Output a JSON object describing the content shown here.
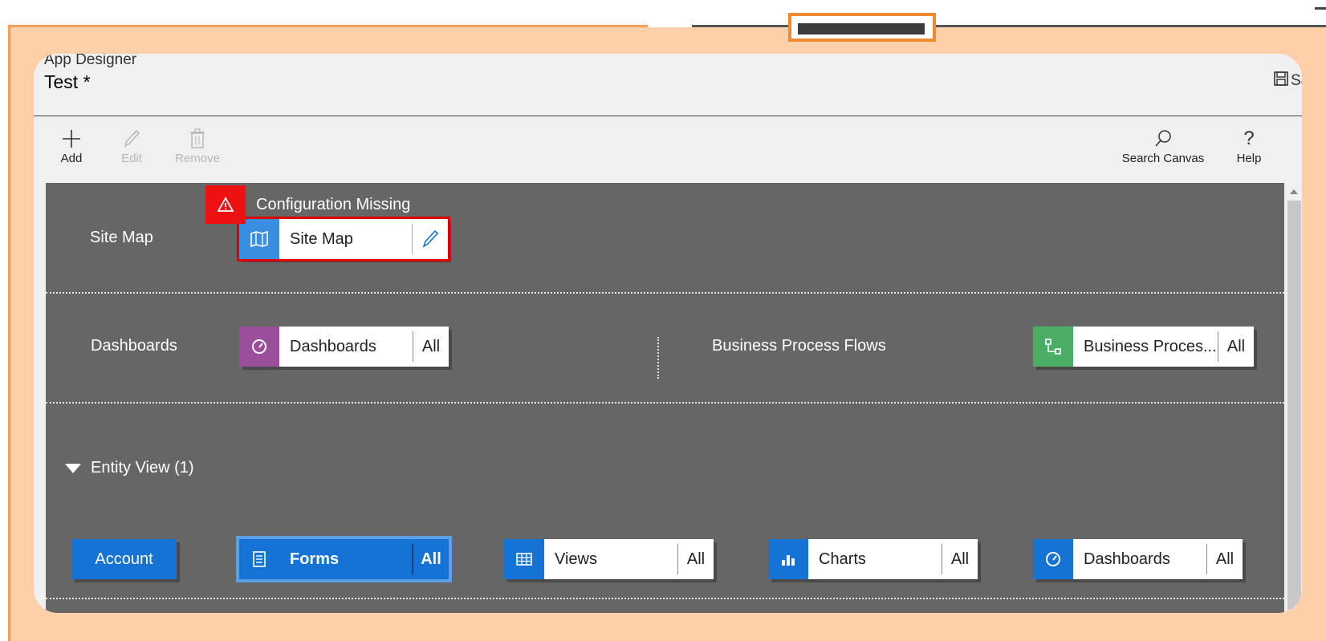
{
  "header": {
    "app_label": "App Designer",
    "title": "Test *",
    "save_label": "Sa"
  },
  "toolbar": {
    "add": "Add",
    "edit": "Edit",
    "remove": "Remove",
    "search_canvas": "Search Canvas",
    "help": "Help"
  },
  "sitemap_row": {
    "label": "Site Map",
    "warning": "Configuration Missing",
    "tile_label": "Site Map"
  },
  "dashboards_row": {
    "label": "Dashboards",
    "tile_label": "Dashboards",
    "tile_all": "All",
    "bpf_label": "Business Process Flows",
    "bpf_tile_label": "Business Proces...",
    "bpf_tile_all": "All"
  },
  "entity_view": {
    "toggle_label": "Entity View (1)",
    "entity": "Account",
    "tiles": [
      {
        "label": "Forms",
        "all": "All"
      },
      {
        "label": "Views",
        "all": "All"
      },
      {
        "label": "Charts",
        "all": "All"
      },
      {
        "label": "Dashboards",
        "all": "All"
      }
    ]
  },
  "colors": {
    "accent_blue": "#1573d6",
    "dashboard_purple": "#9b4f9b",
    "bpf_green": "#4cae66",
    "error_red": "#e11111",
    "canvas_gray": "#666666"
  }
}
